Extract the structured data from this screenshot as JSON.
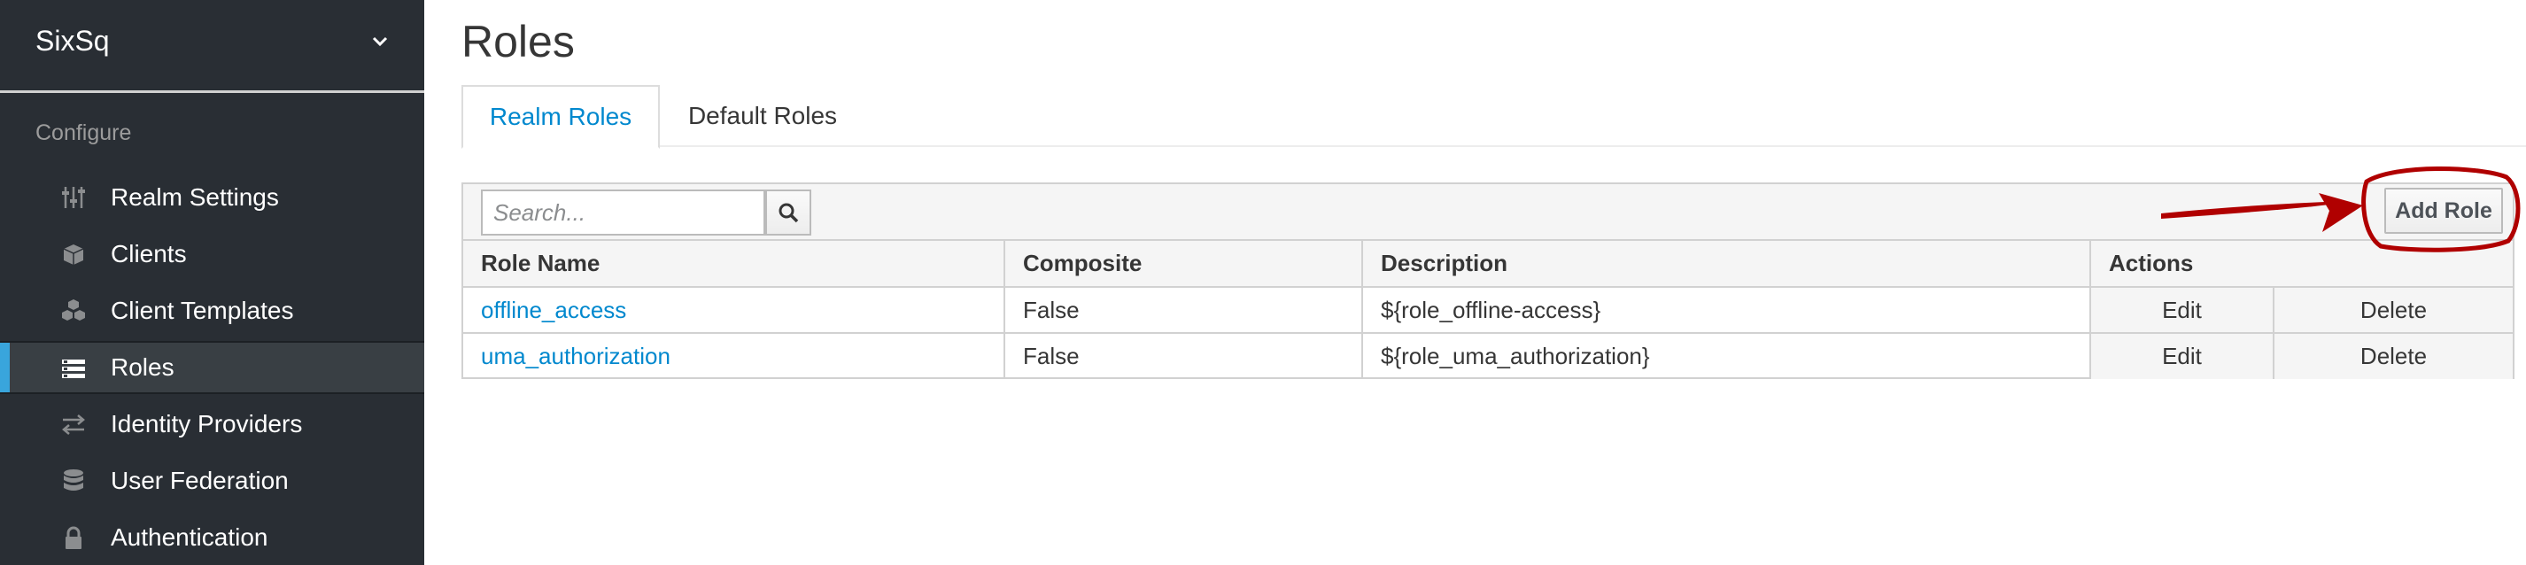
{
  "sidebar": {
    "realm_name": "SixSq",
    "section_label": "Configure",
    "items": [
      {
        "label": "Realm Settings",
        "icon": "sliders-icon",
        "active": false
      },
      {
        "label": "Clients",
        "icon": "cube-icon",
        "active": false
      },
      {
        "label": "Client Templates",
        "icon": "cubes-icon",
        "active": false
      },
      {
        "label": "Roles",
        "icon": "list-icon",
        "active": true
      },
      {
        "label": "Identity Providers",
        "icon": "exchange-icon",
        "active": false
      },
      {
        "label": "User Federation",
        "icon": "database-icon",
        "active": false
      },
      {
        "label": "Authentication",
        "icon": "lock-icon",
        "active": false
      }
    ]
  },
  "main": {
    "title": "Roles",
    "tabs": [
      {
        "label": "Realm Roles",
        "active": true
      },
      {
        "label": "Default Roles",
        "active": false
      }
    ],
    "search": {
      "placeholder": "Search...",
      "value": ""
    },
    "add_role_label": "Add Role",
    "table": {
      "headers": [
        "Role Name",
        "Composite",
        "Description",
        "Actions"
      ],
      "rows": [
        {
          "name": "offline_access",
          "composite": "False",
          "description": "${role_offline-access}",
          "edit": "Edit",
          "delete": "Delete"
        },
        {
          "name": "uma_authorization",
          "composite": "False",
          "description": "${role_uma_authorization}",
          "edit": "Edit",
          "delete": "Delete"
        }
      ]
    }
  },
  "colors": {
    "sidebar_bg": "#292e34",
    "accent": "#39a5dc",
    "link": "#0088ce",
    "annotation": "#b00000"
  }
}
